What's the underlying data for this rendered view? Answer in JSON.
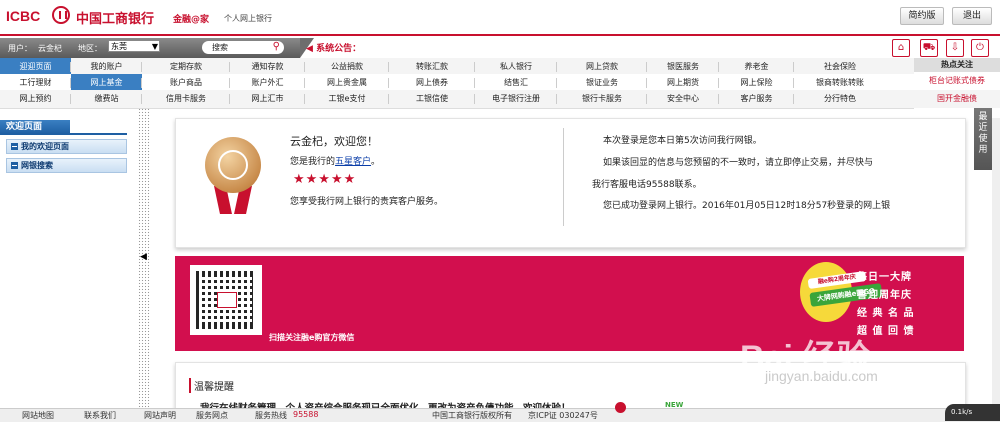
{
  "header": {
    "logo_text": "ICBC",
    "bank_name": "中国工商银行",
    "slogan": "金融@家",
    "subtitle": "个人网上银行",
    "simple_label": "简约版",
    "logout_label": "退出"
  },
  "userbar": {
    "user_label": "用户：",
    "user_name": "云金杞",
    "region_label": "地区：",
    "region_value": "东莞",
    "search_placeholder": "搜索",
    "notice_label": "系统公告："
  },
  "nav": {
    "row1": [
      "迎迎页面",
      "我的账户",
      "定期存款",
      "通知存款",
      "公益捐款",
      "转账汇款",
      "私人银行",
      "网上贷款",
      "银医服务",
      "养老金",
      "社会保险"
    ],
    "row2": [
      "工行理财",
      "网上基金",
      "账户商品",
      "账户外汇",
      "网上贵金属",
      "网上债券",
      "结售汇",
      "银证业务",
      "网上期货",
      "网上保险",
      "银商转账转账"
    ],
    "row3": [
      "网上预约",
      "缴费站",
      "信用卡服务",
      "网上汇市",
      "工银e支付",
      "工银信使",
      "电子银行注册",
      "银行卡服务",
      "安全中心",
      "客户服务",
      "分行特色"
    ],
    "hot_title": "热点关注",
    "hot1": "柜台记账式债券",
    "hot2": "国开金融债"
  },
  "sidebar": {
    "title": "欢迎页面",
    "items": [
      "我的欢迎页面",
      "网银搜索"
    ]
  },
  "welcome": {
    "greeting": "云金杞，欢迎您！",
    "level_prefix": "您是我行的",
    "level_link": "五星客户",
    "level_suffix": "。",
    "stars": "★★★★★",
    "vip_text": "您享受我行网上银行的贵宾客户服务。",
    "login_count": "本次登录是您本日第5次访问我行网银。",
    "warning_1": "如果该回显的信息与您预留的不一致时，请立即停止交易，并尽快与",
    "warning_2": "我行客服电话95588联系。",
    "success": "您已成功登录网上银行。2016年01月05日12时18分57秒登录的网上银"
  },
  "banner": {
    "caption": "扫描关注融e购官方微信",
    "promo_lines": [
      "每日一大牌",
      "喜迎周年庆",
      "经 典 名 品",
      "超 值 回 馈"
    ],
    "tag_top": "融e购2周年庆",
    "tag_main": "大牌网购融e购GO"
  },
  "tip": {
    "title": "温馨提醒",
    "text": "我行在线财务管理、个人资产综合服务现已全面优化，更改为资产负债功能，欢迎体验！",
    "badge": "NEW"
  },
  "recent_tab": "最近使用",
  "footer": {
    "links": [
      "网站地图",
      "联系我们",
      "网站声明",
      "服务网点",
      "服务热线",
      "95588"
    ],
    "copyright": "中国工商银行版权所有",
    "icp": "京ICP证 030247号",
    "speed": "0.1k/s"
  },
  "watermark": {
    "main": "Bai 经验",
    "url": "jingyan.baidu.com"
  },
  "colors": {
    "brand_red": "#c8102e",
    "banner_pink": "#d20f4e",
    "sidebar_blue": "#1e5fa3"
  }
}
